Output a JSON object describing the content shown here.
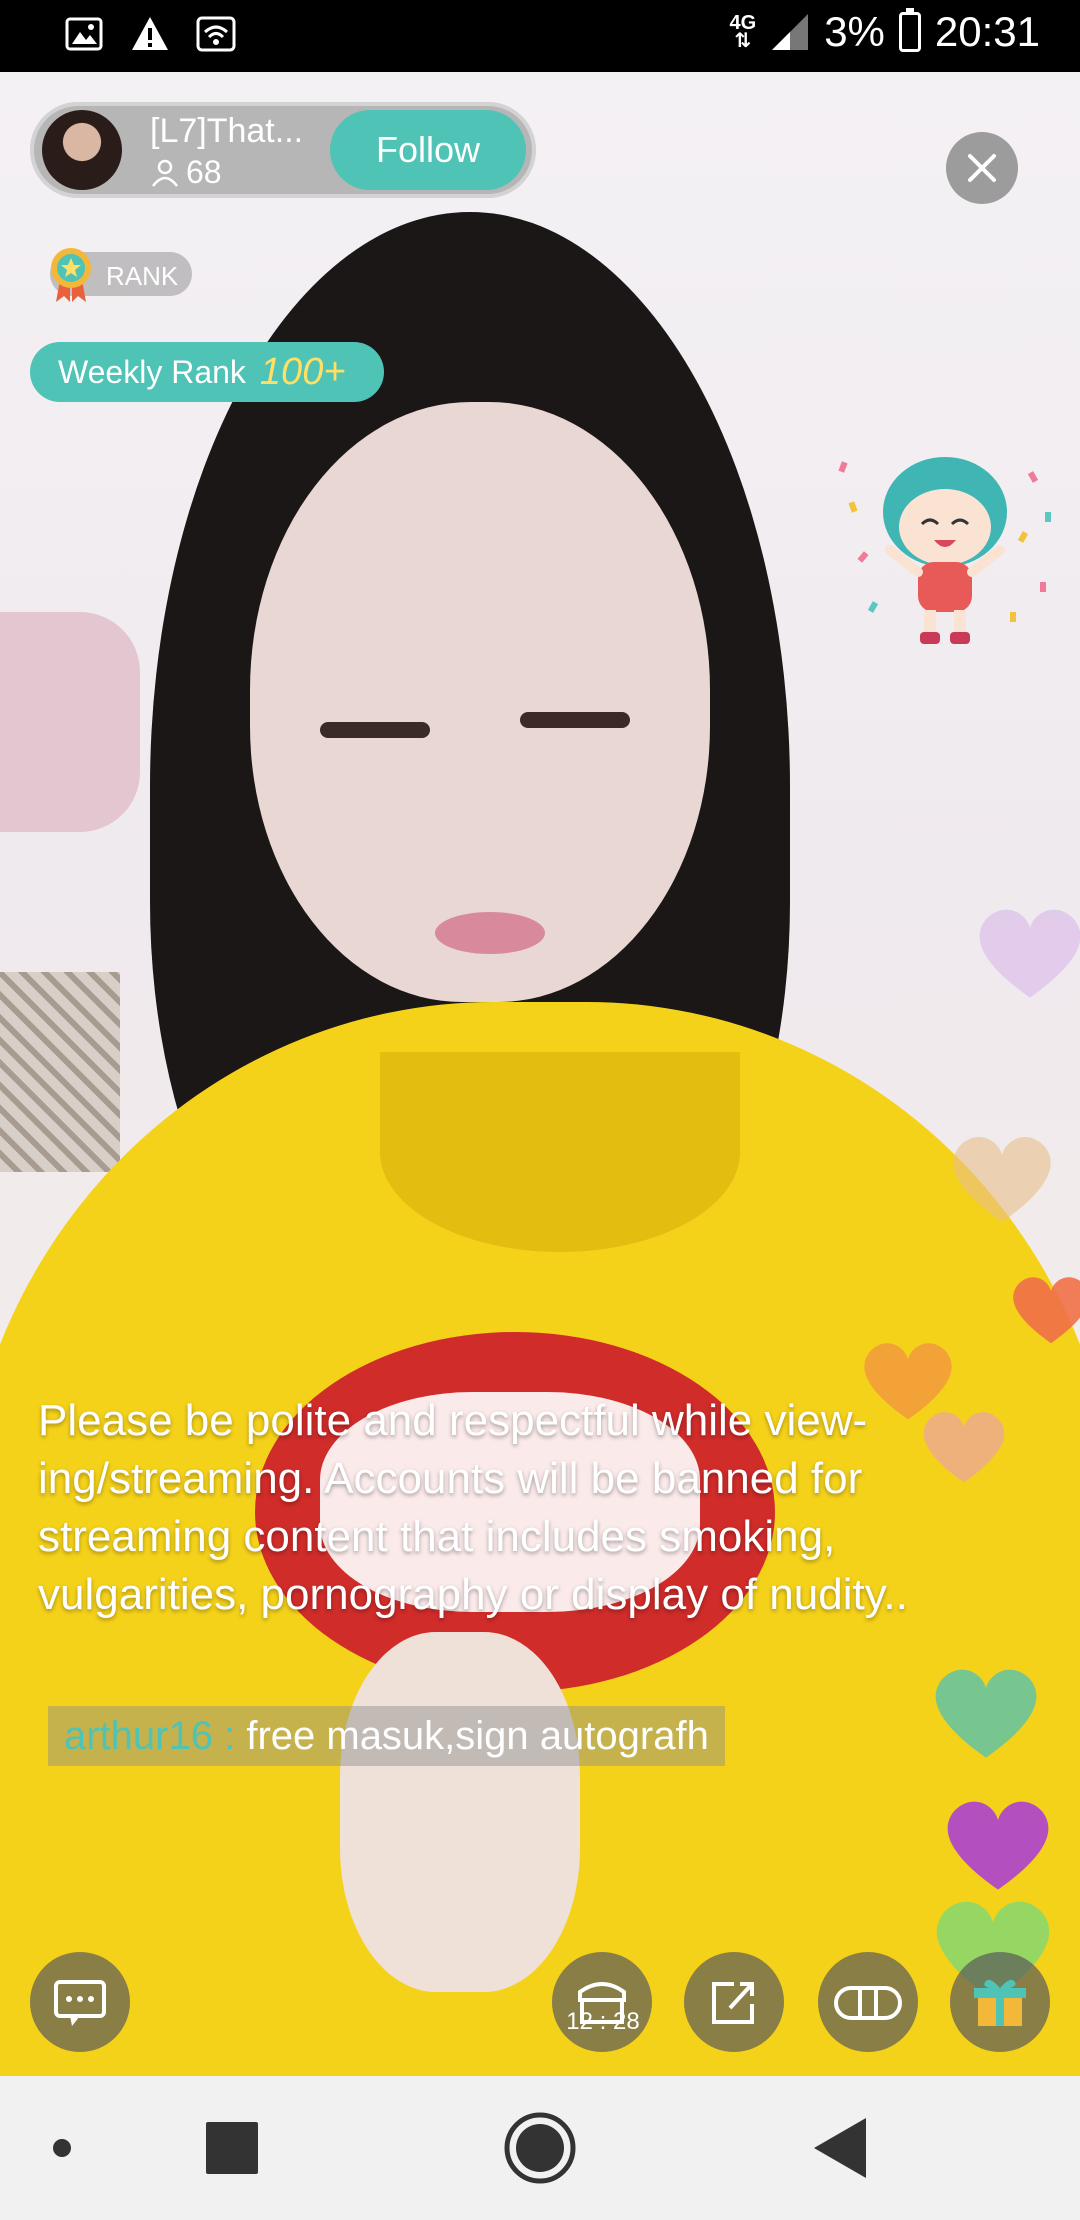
{
  "status_bar": {
    "left_icons": [
      "image-icon",
      "alert-icon",
      "wifi-icon"
    ],
    "network": "4G",
    "battery": "3%",
    "time": "20:31"
  },
  "host": {
    "name": "[L7]That...",
    "viewers": "68",
    "follow_label": "Follow"
  },
  "rank": {
    "badge_label": "RANK",
    "weekly_label": "Weekly Rank",
    "weekly_value": "100+"
  },
  "notice": {
    "line1": "Please be polite and respectful while view-",
    "line2": "ing/streaming. Accounts will be banned for",
    "line3": "streaming content that includes smoking,",
    "line4": "vulgarities, pornography or display of nudity.."
  },
  "chat": [
    {
      "user": "arthur16",
      "separator": " : ",
      "message": "free masuk,sign autografh"
    }
  ],
  "actions": {
    "pk_time": "12 : 28"
  },
  "colors": {
    "accent": "#4fc3b5",
    "rank_number": "#ffe066"
  },
  "hearts": [
    {
      "color": "#d9b8ea"
    },
    {
      "color": "#e8c08a"
    },
    {
      "color": "#f07048"
    },
    {
      "color": "#f29a3c"
    },
    {
      "color": "#ea9cbc"
    },
    {
      "color": "#62c4a4"
    },
    {
      "color": "#b048c8"
    },
    {
      "color": "#86d870"
    }
  ]
}
